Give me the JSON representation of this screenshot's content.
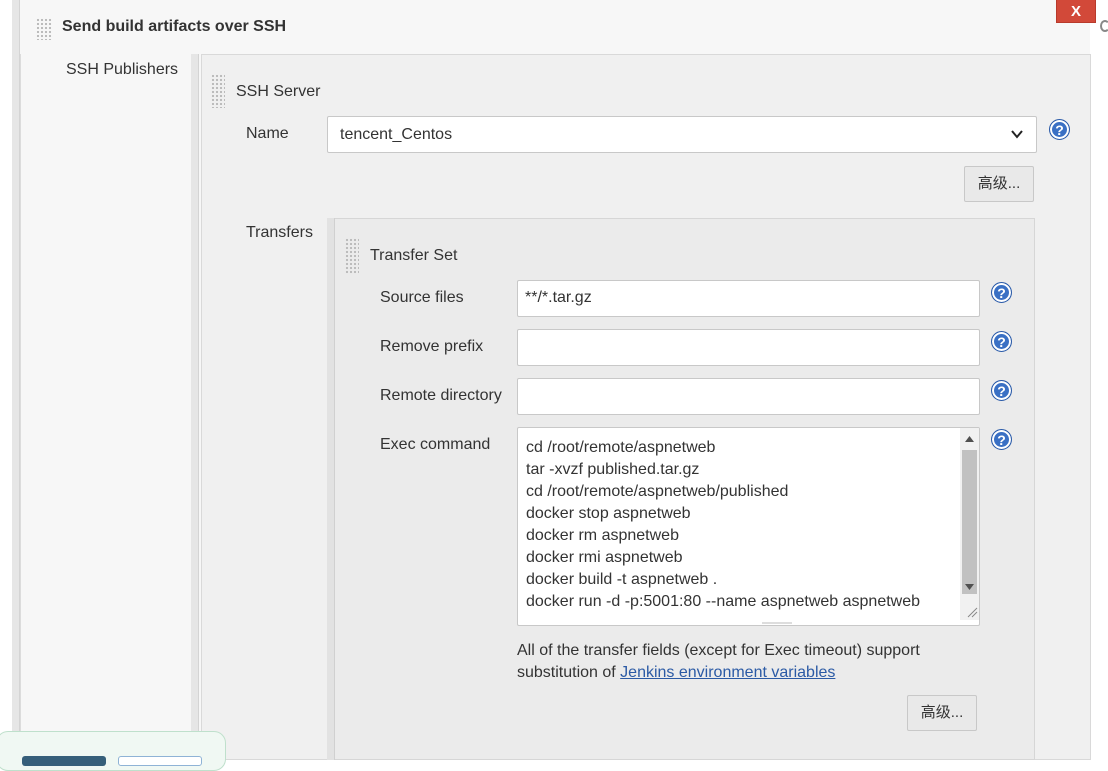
{
  "section": {
    "title": "Send build artifacts over SSH",
    "close_label": "X"
  },
  "ssh_publishers": {
    "label": "SSH Publishers",
    "server": {
      "title": "SSH Server",
      "name_label": "Name",
      "name_value": "tencent_Centos",
      "advanced_label": "高级..."
    }
  },
  "transfers": {
    "label": "Transfers",
    "set_title": "Transfer Set",
    "source_files": {
      "label": "Source files",
      "value": "**/*.tar.gz"
    },
    "remove_prefix": {
      "label": "Remove prefix",
      "value": ""
    },
    "remote_directory": {
      "label": "Remote directory",
      "value": ""
    },
    "exec_command": {
      "label": "Exec command",
      "lines": [
        "cd /root/remote/aspnetweb",
        "tar -xvzf published.tar.gz",
        "cd /root/remote/aspnetweb/published",
        "docker stop aspnetweb",
        "docker rm aspnetweb",
        "docker rmi aspnetweb",
        "docker build -t aspnetweb .",
        "docker run -d -p:5001:80 --name aspnetweb aspnetweb"
      ]
    },
    "note_line1": "All of the transfer fields (except for Exec timeout) support",
    "note_line2_prefix": "substitution of ",
    "note_link": "Jenkins environment variables",
    "advanced_label": "高级..."
  },
  "help_icon_glyph": "?",
  "colors": {
    "close_bg": "#d24939",
    "help_bg": "#3a70c4",
    "link": "#2b5aa5"
  }
}
